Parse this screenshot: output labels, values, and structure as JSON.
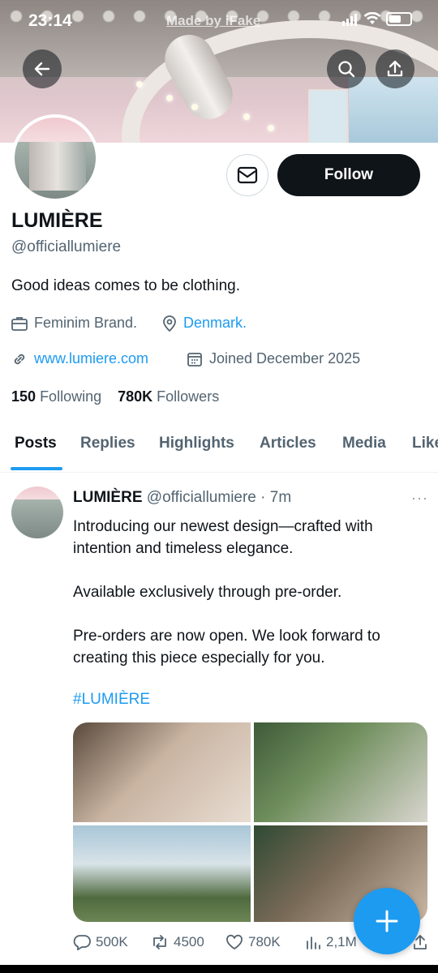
{
  "status_bar": {
    "time": "23:14",
    "watermark": "Made by iFake"
  },
  "profile": {
    "name": "LUMIÈRE",
    "handle": "@officiallumiere",
    "bio": "Good ideas comes to be clothing.",
    "category": "Feminim Brand.",
    "location": "Denmark.",
    "website": "www.lumiere.com",
    "joined": "Joined December 2025",
    "following_count": "150",
    "following_label": "Following",
    "followers_count": "780K",
    "followers_label": "Followers",
    "follow_label": "Follow"
  },
  "tabs": [
    "Posts",
    "Replies",
    "Highlights",
    "Articles",
    "Media",
    "Likes"
  ],
  "active_tab": "Posts",
  "post": {
    "author_name": "LUMIÈRE",
    "author_handle": "@officiallumiere",
    "time": "· 7m",
    "more": "···",
    "lines": [
      "Introducing our newest design—crafted with",
      "intention and timeless elegance.",
      "Available exclusively through pre-order.",
      "Pre-orders are now open. We look forward to",
      "creating this piece especially for you."
    ],
    "hashtag": "#LUMIÈRE",
    "replies": "500K",
    "reposts": "4500",
    "likes": "780K",
    "views": "2,1M"
  },
  "colors": {
    "accent": "#1d9bf0",
    "text": "#0f1419",
    "secondary": "#536471"
  }
}
